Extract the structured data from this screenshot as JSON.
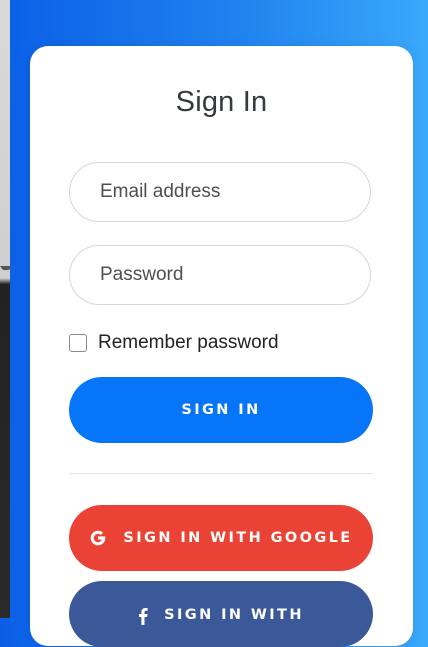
{
  "colors": {
    "background_gradient_start": "#0b5fe6",
    "background_gradient_end": "#3aa8fb",
    "primary_button": "#0775f7",
    "google_button": "#ea4335",
    "facebook_button": "#3b5998"
  },
  "form": {
    "title": "Sign In",
    "email_placeholder": "Email address",
    "password_placeholder": "Password",
    "remember_label": "Remember password",
    "remember_checked": false,
    "sign_in_label": "SIGN IN",
    "google_label": "SIGN IN WITH GOOGLE",
    "google_icon": "google-icon",
    "facebook_label": "SIGN IN WITH",
    "facebook_icon": "facebook-icon"
  }
}
